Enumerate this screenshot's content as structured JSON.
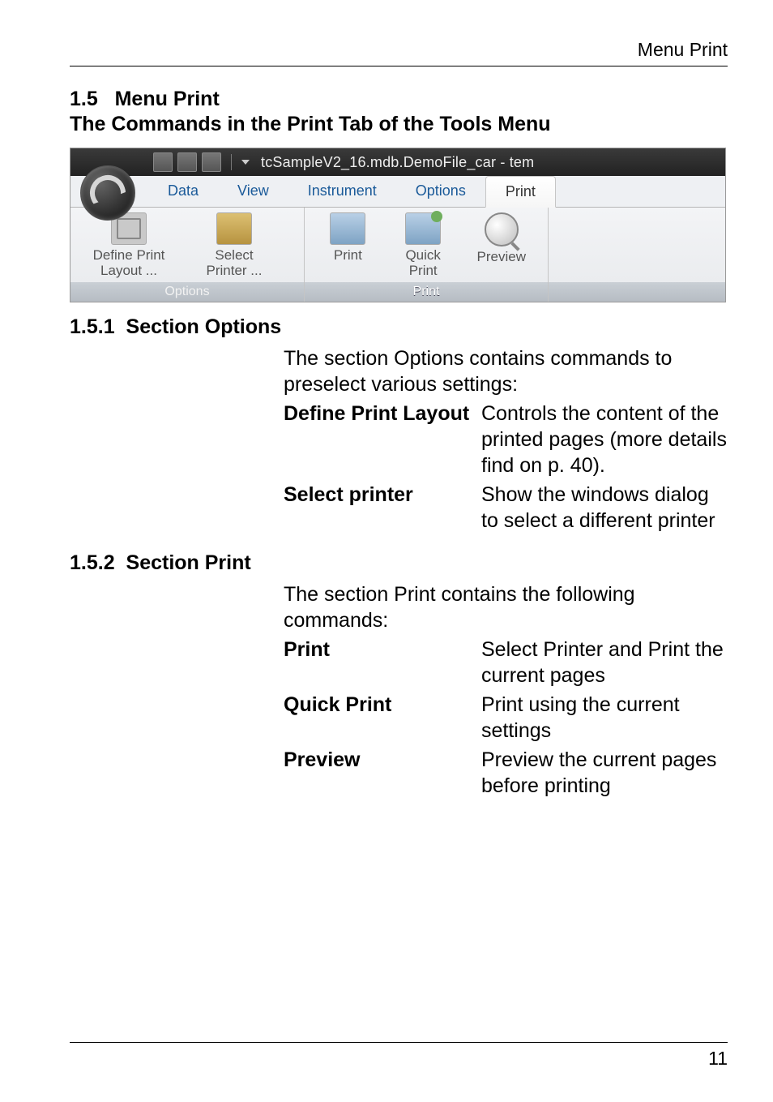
{
  "running_head": "Menu Print",
  "section": {
    "number": "1.5",
    "title": "Menu Print",
    "subtitle": "The Commands in the Print Tab of the Tools Menu"
  },
  "ribbon": {
    "window_filename": "tcSampleV2_16.mdb.DemoFile_car - tem",
    "tabs": [
      "Data",
      "View",
      "Instrument",
      "Options",
      "Print"
    ],
    "active_tab": "Print",
    "groups": [
      {
        "name": "Options",
        "buttons": [
          {
            "line1": "Define Print",
            "line2": "Layout ..."
          },
          {
            "line1": "Select",
            "line2": "Printer ..."
          }
        ]
      },
      {
        "name": "Print",
        "buttons": [
          {
            "line1": "Print",
            "line2": ""
          },
          {
            "line1": "Quick",
            "line2": "Print"
          },
          {
            "line1": "Preview",
            "line2": ""
          }
        ]
      }
    ]
  },
  "sub1": {
    "num": "1.5.1",
    "title": "Section Options",
    "intro": "The section Options contains  commands to preselect various settings:",
    "defs": [
      {
        "term": "Define Print Layout",
        "desc": "Controls the content of the printed pages (more details find on p. 40)."
      },
      {
        "term": "Select printer",
        "desc": "Show the windows dialog to select a different printer"
      }
    ]
  },
  "sub2": {
    "num": "1.5.2",
    "title": "Section Print",
    "intro": "The section Print contains the following commands:",
    "defs": [
      {
        "term": "Print",
        "desc": "Select Printer and Print the current pages"
      },
      {
        "term": "Quick Print",
        "desc": "Print using the current settings"
      },
      {
        "term": "Preview",
        "desc": "Preview the current pages before printing"
      }
    ]
  },
  "page_number": "11"
}
